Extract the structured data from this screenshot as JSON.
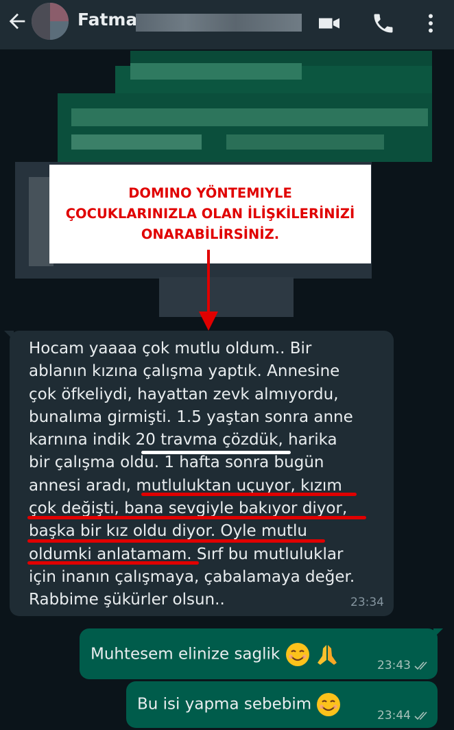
{
  "header": {
    "contact_name": "Fatma"
  },
  "annotation": {
    "lines": [
      "DOMINO YÖNTEMIYLE",
      "ÇOCUKLARINIZLA OLAN İLİŞKİLERİNİZİ",
      "ONARABİLİRSİNİZ."
    ],
    "color": "#e00000"
  },
  "messages": {
    "incoming": {
      "text": "Hocam yaaaa çok mutlu oldum.. Bir\nablanın kızına çalışma yaptık. Annesine\nçok öfkeliydi, hayattan zevk almıyordu,\nbunalıma girmişti. 1.5 yaştan sonra anne\nkarnına indik 20 travma çözdük, harika\nbir çalışma oldu. 1 hafta sonra bugün\nannesi aradı, mutluluktan uçuyor, kızım\nçok değişti, bana sevgiyle bakıyor diyor,\nbaşka bir kız oldu diyor. Oyle mutlu\noldumki anlatamam. Sırf bu mutluluklar\niçin inanın çalışmaya, çabalamaya değer.\nRabbime şükürler olsun..",
      "time": "23:34"
    },
    "outgoing": [
      {
        "text": "Muhtesem elinize saglik",
        "emojis": [
          "smiling-face-icon",
          "praying-hands-icon"
        ],
        "time": "23:43",
        "status": "read-double-check-icon"
      },
      {
        "text": "Bu isi yapma sebebim",
        "emojis": [
          "smiling-face-icon"
        ],
        "time": "23:44",
        "status": "read-double-check-icon"
      }
    ]
  },
  "colors": {
    "header_bg": "#1f2c34",
    "chat_bg": "#0b141a",
    "incoming_bubble": "#1f2c34",
    "outgoing_bubble": "#005c4b",
    "underline_white": "#ffffff",
    "underline_red": "#e00000"
  }
}
